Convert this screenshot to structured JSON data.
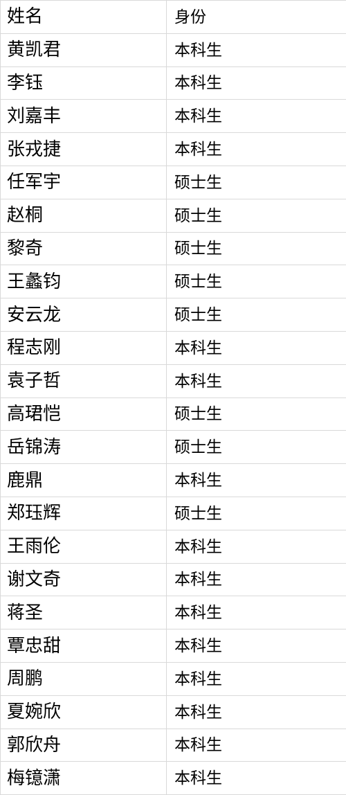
{
  "table": {
    "columns": [
      {
        "key": "name",
        "label": "姓名"
      },
      {
        "key": "identity",
        "label": "身份"
      }
    ],
    "rows": [
      {
        "name": "黄凯君",
        "identity": "本科生"
      },
      {
        "name": "李钰",
        "identity": "本科生"
      },
      {
        "name": "刘嘉丰",
        "identity": "本科生"
      },
      {
        "name": "张戎捷",
        "identity": "本科生"
      },
      {
        "name": "任军宇",
        "identity": "硕士生"
      },
      {
        "name": "赵桐",
        "identity": "硕士生"
      },
      {
        "name": "黎奇",
        "identity": "硕士生"
      },
      {
        "name": "王蠡钧",
        "identity": "硕士生"
      },
      {
        "name": "安云龙",
        "identity": "硕士生"
      },
      {
        "name": "程志刚",
        "identity": "本科生"
      },
      {
        "name": "袁子哲",
        "identity": "本科生"
      },
      {
        "name": "高珺恺",
        "identity": "硕士生"
      },
      {
        "name": "岳锦涛",
        "identity": "硕士生"
      },
      {
        "name": "鹿鼎",
        "identity": "本科生"
      },
      {
        "name": "郑珏辉",
        "identity": "硕士生"
      },
      {
        "name": "王雨伦",
        "identity": "本科生"
      },
      {
        "name": "谢文奇",
        "identity": "本科生"
      },
      {
        "name": "蒋圣",
        "identity": "本科生"
      },
      {
        "name": "覃忠甜",
        "identity": "本科生"
      },
      {
        "name": "周鹏",
        "identity": "本科生"
      },
      {
        "name": "夏婉欣",
        "identity": "本科生"
      },
      {
        "name": "郭欣舟",
        "identity": "本科生"
      },
      {
        "name": "梅镱潇",
        "identity": "本科生"
      }
    ]
  },
  "style": {
    "border_color": "#d9d9d9",
    "background_color": "#ffffff",
    "text_color": "#000000"
  }
}
